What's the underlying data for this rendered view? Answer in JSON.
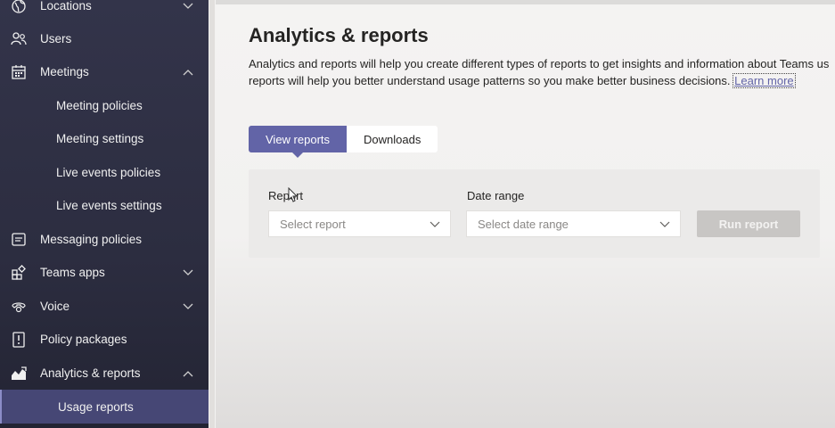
{
  "sidebar": {
    "items": [
      {
        "label": "Locations",
        "icon": "globe-icon",
        "chevron": "down"
      },
      {
        "label": "Users",
        "icon": "users-icon",
        "chevron": ""
      },
      {
        "label": "Meetings",
        "icon": "calendar-icon",
        "chevron": "up"
      },
      {
        "label": "Meeting policies",
        "icon": "",
        "chevron": ""
      },
      {
        "label": "Meeting settings",
        "icon": "",
        "chevron": ""
      },
      {
        "label": "Live events policies",
        "icon": "",
        "chevron": ""
      },
      {
        "label": "Live events settings",
        "icon": "",
        "chevron": ""
      },
      {
        "label": "Messaging policies",
        "icon": "message-icon",
        "chevron": ""
      },
      {
        "label": "Teams apps",
        "icon": "apps-icon",
        "chevron": "down"
      },
      {
        "label": "Voice",
        "icon": "voice-icon",
        "chevron": "down"
      },
      {
        "label": "Policy packages",
        "icon": "policy-package-icon",
        "chevron": ""
      },
      {
        "label": "Analytics & reports",
        "icon": "analytics-icon",
        "chevron": "up"
      },
      {
        "label": "Usage reports",
        "icon": "",
        "chevron": "",
        "selected": true
      }
    ]
  },
  "main": {
    "title": "Analytics & reports",
    "description_line1": "Analytics and reports will help you create different types of reports to get insights and information about Teams us",
    "description_line2": "reports will help you better understand usage patterns so you make better business decisions.",
    "learn_more": "Learn more",
    "tabs": [
      {
        "label": "View reports",
        "active": true
      },
      {
        "label": "Downloads",
        "active": false
      }
    ],
    "report_label": "Report",
    "report_placeholder": "Select report",
    "date_range_label": "Date range",
    "date_range_placeholder": "Select date range",
    "run_button": "Run report"
  },
  "colors": {
    "accent": "#6264a7",
    "sidebar_bg": "#33344a",
    "active_item_bg": "#464775",
    "disabled_button": "#c8c6c4"
  }
}
